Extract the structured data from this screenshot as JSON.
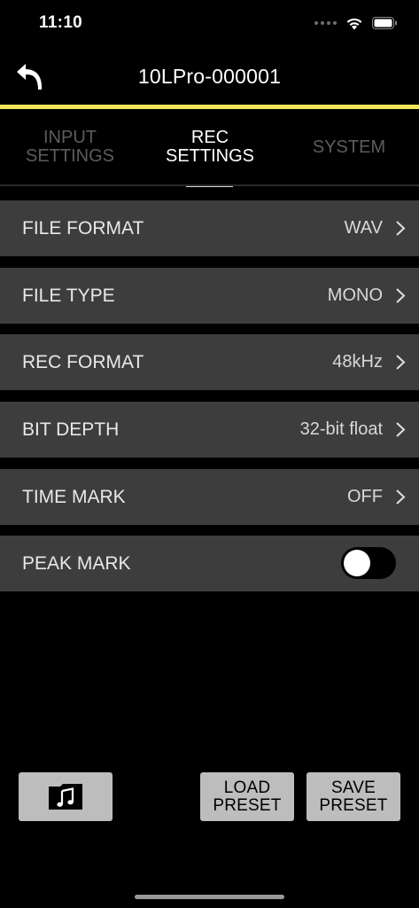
{
  "status_bar": {
    "time": "11:10",
    "icons": [
      "cellular-dots-icon",
      "wifi-icon",
      "battery-icon"
    ]
  },
  "nav": {
    "title": "10LPro-000001",
    "back_icon": "back-arrow-icon"
  },
  "colors": {
    "accent": "#f2e65a",
    "row_background": "#3d3d3d",
    "button_background": "#bdbdbd"
  },
  "tabs": [
    {
      "label": "INPUT\nSETTINGS",
      "active": false
    },
    {
      "label": "REC\nSETTINGS",
      "active": true
    },
    {
      "label": "SYSTEM",
      "active": false
    }
  ],
  "settings": {
    "file_format": {
      "label": "FILE FORMAT",
      "value": "WAV"
    },
    "file_type": {
      "label": "FILE TYPE",
      "value": "MONO"
    },
    "rec_format": {
      "label": "REC FORMAT",
      "value": "48kHz"
    },
    "bit_depth": {
      "label": "BIT DEPTH",
      "value": "32-bit float"
    },
    "time_mark": {
      "label": "TIME MARK",
      "value": "OFF"
    },
    "peak_mark": {
      "label": "PEAK MARK",
      "toggle_on": false
    }
  },
  "buttons": {
    "folder_icon": "music-folder-icon",
    "load_preset": "LOAD\nPRESET",
    "save_preset": "SAVE\nPRESET"
  }
}
